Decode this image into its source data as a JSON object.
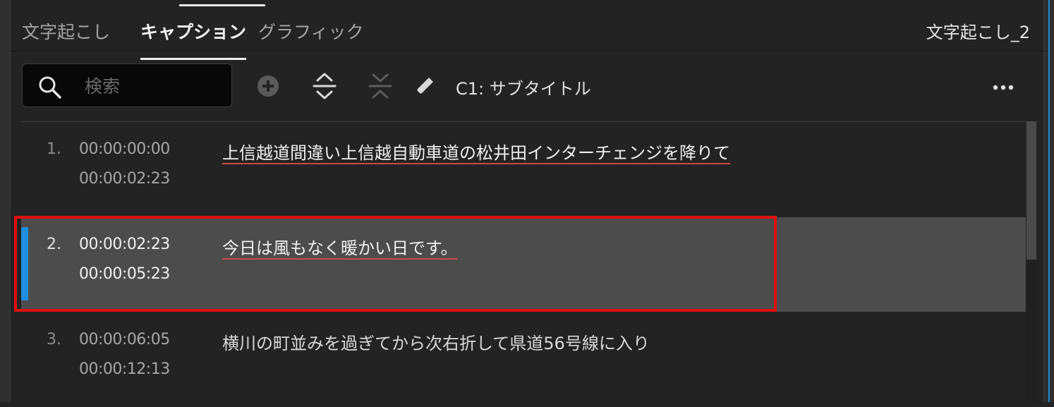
{
  "tabs": [
    {
      "label": "文字起こし",
      "active": false
    },
    {
      "label": "キャプション",
      "active": true
    },
    {
      "label": "グラフィック",
      "active": false
    }
  ],
  "sequence_name": "文字起こし_2",
  "search": {
    "placeholder": "検索",
    "value": ""
  },
  "toolbar": {
    "icons": [
      "add-caption-icon",
      "split-caption-icon",
      "merge-caption-icon",
      "edit-pencil-icon",
      "more-options-icon"
    ],
    "track_label": "C1: サブタイトル"
  },
  "captions": [
    {
      "num": "1.",
      "start": "00:00:00:00",
      "end": "00:00:02:23",
      "text": "上信越道間違い上信越自動車道の松井田インターチェンジを降りて",
      "selected": false
    },
    {
      "num": "2.",
      "start": "00:00:02:23",
      "end": "00:00:05:23",
      "text": "今日は風もなく暖かい日です。",
      "selected": true
    },
    {
      "num": "3.",
      "start": "00:00:06:05",
      "end": "00:00:12:13",
      "text": "横川の町並みを過ぎてから次右折して県道56号線に入り",
      "selected": false
    }
  ],
  "colors": {
    "accent": "#1f8fe0",
    "highlight": "#e01010",
    "background": "#232323"
  }
}
